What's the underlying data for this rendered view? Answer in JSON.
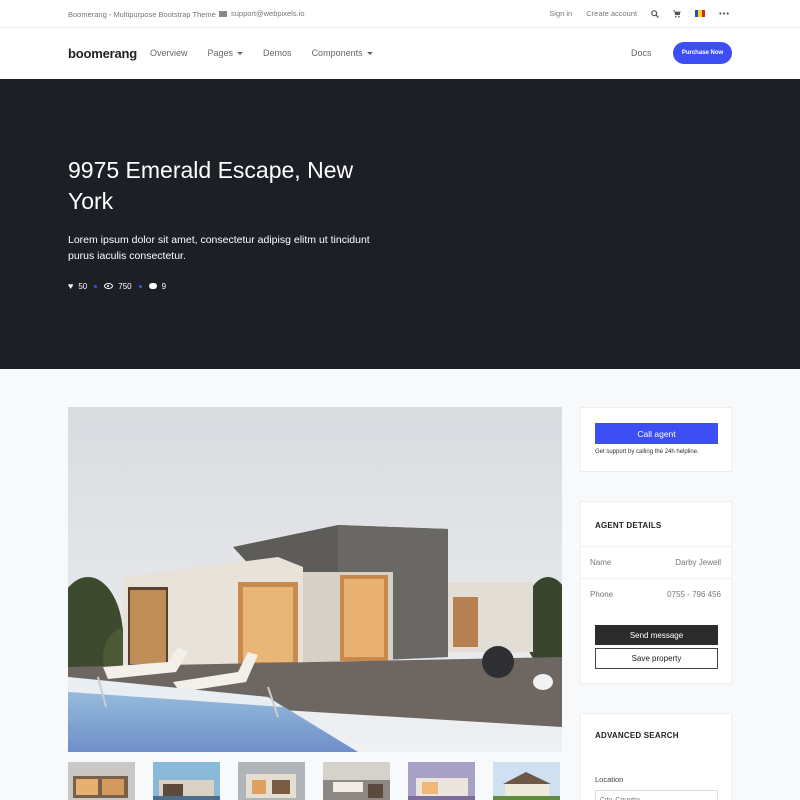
{
  "topbar": {
    "brand_text": "Boomerang - Multipurpose Bootstrap Theme",
    "email": "support@webpixels.io",
    "sign_in": "Sign in",
    "create_account": "Create account",
    "more": "•••"
  },
  "nav": {
    "logo": "boomerang",
    "overview": "Overview",
    "pages": "Pages",
    "demos": "Demos",
    "components": "Components",
    "docs": "Docs",
    "purchase": "Purchase Now"
  },
  "hero": {
    "title": "9975 Emerald Escape, New York",
    "description": "Lorem ipsum dolor sit amet, consectetur adipisg elitm ut tincidunt purus iaculis consectetur.",
    "likes": "50",
    "views": "750",
    "comments": "9"
  },
  "call_card": {
    "button": "Call agent",
    "note": "Get support by calling the 24h helpline."
  },
  "agent_card": {
    "title": "AGENT DETAILS",
    "name_label": "Name",
    "name_value": "Darby Jewell",
    "phone_label": "Phone",
    "phone_value": "0755 - 796 456",
    "send_button": "Send message",
    "save_button": "Save property"
  },
  "search_card": {
    "title": "ADVANCED SEARCH",
    "location_label": "Location",
    "location_placeholder": "City, Country"
  },
  "colors": {
    "accent": "#3d4ef5",
    "hero_bg": "#1d1f26"
  }
}
